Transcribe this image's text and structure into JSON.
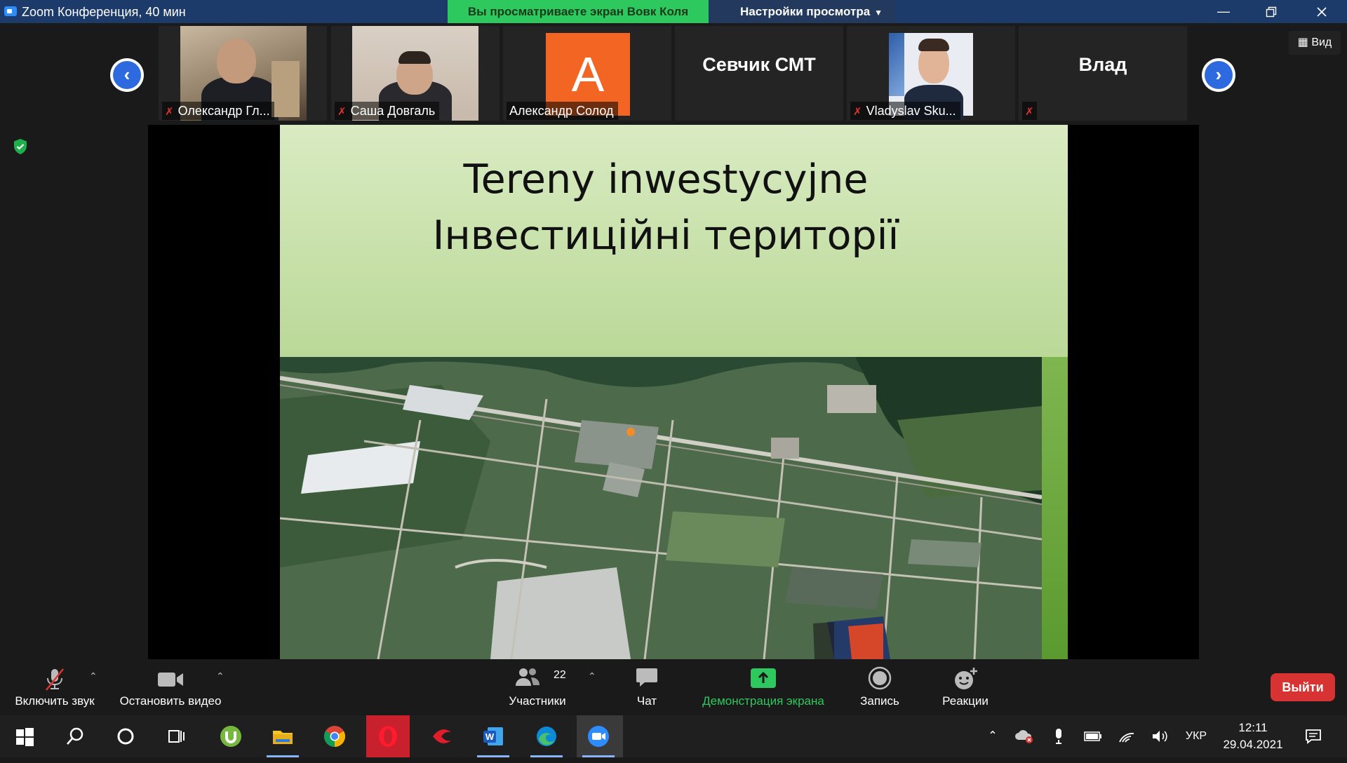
{
  "window": {
    "title": "Zoom Конференция, 40 мин",
    "viewing_banner": "Вы просматриваете экран Вовк Коля",
    "view_settings": "Настройки просмотра"
  },
  "participants": [
    {
      "name": "Олександр Гл...",
      "muted": true,
      "type": "video"
    },
    {
      "name": "Саша Довгаль",
      "muted": true,
      "type": "video"
    },
    {
      "name": "Александр Солод",
      "muted": false,
      "type": "avatar",
      "avatar_letter": "A",
      "avatar_color": "#f26522"
    },
    {
      "name": "Севчик СМТ",
      "muted": false,
      "type": "name-only"
    },
    {
      "name": "Vladyslav Sku...",
      "muted": true,
      "type": "video"
    },
    {
      "name": "Влад",
      "muted": true,
      "type": "name-only"
    }
  ],
  "view_button": "Вид",
  "slide": {
    "title_line1": "Tereny inwestycyjne",
    "title_line2": "Інвестиційні території"
  },
  "toolbar": {
    "audio": "Включить звук",
    "video": "Остановить видео",
    "participants": "Участники",
    "participants_count": "22",
    "chat": "Чат",
    "share": "Демонстрация экрана",
    "record": "Запись",
    "reactions": "Реакции",
    "leave": "Выйти"
  },
  "taskbar": {
    "language": "УКР",
    "time": "12:11",
    "date": "29.04.2021"
  },
  "colors": {
    "titlebar": "#1c3b6b",
    "banner": "#2ec95e",
    "share_green": "#2ec95e",
    "leave_red": "#d83333",
    "nav_blue": "#2d6ae0"
  }
}
